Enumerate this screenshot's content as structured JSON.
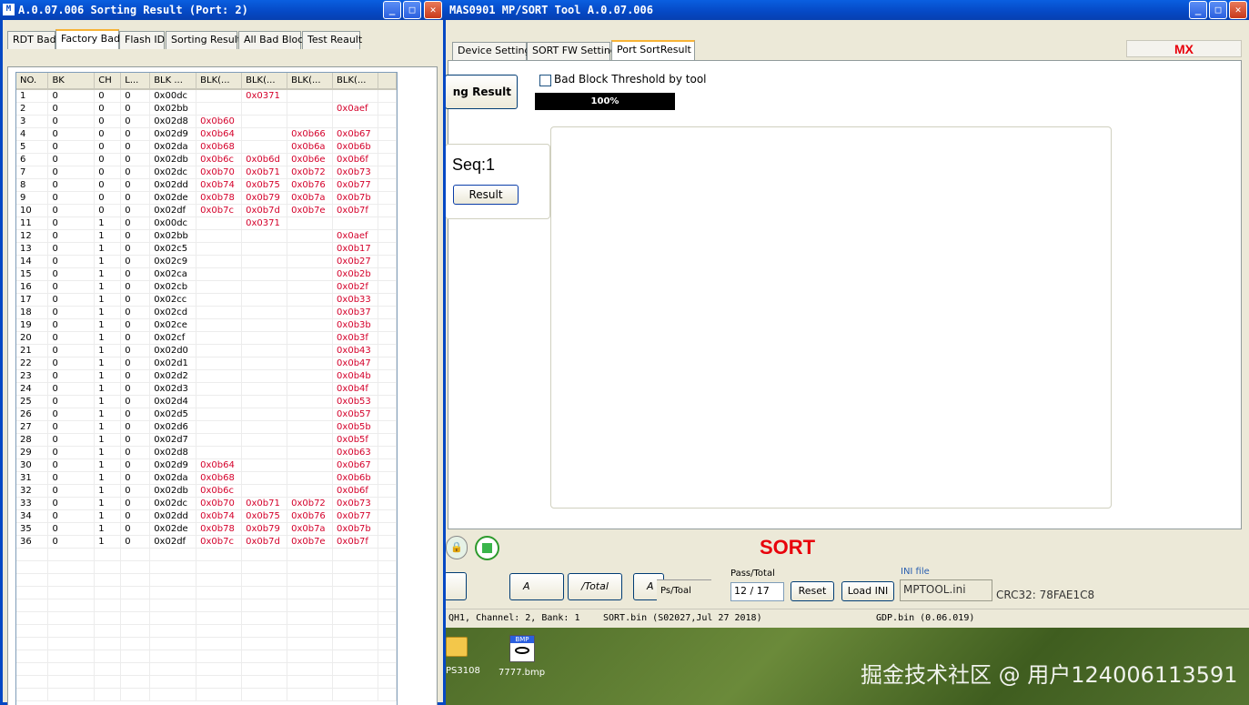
{
  "left_window": {
    "title": "A.0.07.006 Sorting Result (Port: 2)",
    "tabs": [
      "RDT Bad",
      "Factory Bad",
      "Flash ID",
      "Sorting Result",
      "All Bad Block",
      "Test Reault"
    ],
    "selected_tab": 1,
    "columns": [
      "NO.",
      "BK",
      "CH",
      "L...",
      "BLK ...",
      "BLK(...",
      "BLK(...",
      "BLK(...",
      "BLK(..."
    ],
    "rows": [
      [
        "1",
        "0",
        "0",
        "0",
        "0x00dc",
        "",
        "0x0371",
        "",
        ""
      ],
      [
        "2",
        "0",
        "0",
        "0",
        "0x02bb",
        "",
        "",
        "",
        "0x0aef"
      ],
      [
        "3",
        "0",
        "0",
        "0",
        "0x02d8",
        "0x0b60",
        "",
        "",
        ""
      ],
      [
        "4",
        "0",
        "0",
        "0",
        "0x02d9",
        "0x0b64",
        "",
        "0x0b66",
        "0x0b67"
      ],
      [
        "5",
        "0",
        "0",
        "0",
        "0x02da",
        "0x0b68",
        "",
        "0x0b6a",
        "0x0b6b"
      ],
      [
        "6",
        "0",
        "0",
        "0",
        "0x02db",
        "0x0b6c",
        "0x0b6d",
        "0x0b6e",
        "0x0b6f"
      ],
      [
        "7",
        "0",
        "0",
        "0",
        "0x02dc",
        "0x0b70",
        "0x0b71",
        "0x0b72",
        "0x0b73"
      ],
      [
        "8",
        "0",
        "0",
        "0",
        "0x02dd",
        "0x0b74",
        "0x0b75",
        "0x0b76",
        "0x0b77"
      ],
      [
        "9",
        "0",
        "0",
        "0",
        "0x02de",
        "0x0b78",
        "0x0b79",
        "0x0b7a",
        "0x0b7b"
      ],
      [
        "10",
        "0",
        "0",
        "0",
        "0x02df",
        "0x0b7c",
        "0x0b7d",
        "0x0b7e",
        "0x0b7f"
      ],
      [
        "11",
        "0",
        "1",
        "0",
        "0x00dc",
        "",
        "0x0371",
        "",
        ""
      ],
      [
        "12",
        "0",
        "1",
        "0",
        "0x02bb",
        "",
        "",
        "",
        "0x0aef"
      ],
      [
        "13",
        "0",
        "1",
        "0",
        "0x02c5",
        "",
        "",
        "",
        "0x0b17"
      ],
      [
        "14",
        "0",
        "1",
        "0",
        "0x02c9",
        "",
        "",
        "",
        "0x0b27"
      ],
      [
        "15",
        "0",
        "1",
        "0",
        "0x02ca",
        "",
        "",
        "",
        "0x0b2b"
      ],
      [
        "16",
        "0",
        "1",
        "0",
        "0x02cb",
        "",
        "",
        "",
        "0x0b2f"
      ],
      [
        "17",
        "0",
        "1",
        "0",
        "0x02cc",
        "",
        "",
        "",
        "0x0b33"
      ],
      [
        "18",
        "0",
        "1",
        "0",
        "0x02cd",
        "",
        "",
        "",
        "0x0b37"
      ],
      [
        "19",
        "0",
        "1",
        "0",
        "0x02ce",
        "",
        "",
        "",
        "0x0b3b"
      ],
      [
        "20",
        "0",
        "1",
        "0",
        "0x02cf",
        "",
        "",
        "",
        "0x0b3f"
      ],
      [
        "21",
        "0",
        "1",
        "0",
        "0x02d0",
        "",
        "",
        "",
        "0x0b43"
      ],
      [
        "22",
        "0",
        "1",
        "0",
        "0x02d1",
        "",
        "",
        "",
        "0x0b47"
      ],
      [
        "23",
        "0",
        "1",
        "0",
        "0x02d2",
        "",
        "",
        "",
        "0x0b4b"
      ],
      [
        "24",
        "0",
        "1",
        "0",
        "0x02d3",
        "",
        "",
        "",
        "0x0b4f"
      ],
      [
        "25",
        "0",
        "1",
        "0",
        "0x02d4",
        "",
        "",
        "",
        "0x0b53"
      ],
      [
        "26",
        "0",
        "1",
        "0",
        "0x02d5",
        "",
        "",
        "",
        "0x0b57"
      ],
      [
        "27",
        "0",
        "1",
        "0",
        "0x02d6",
        "",
        "",
        "",
        "0x0b5b"
      ],
      [
        "28",
        "0",
        "1",
        "0",
        "0x02d7",
        "",
        "",
        "",
        "0x0b5f"
      ],
      [
        "29",
        "0",
        "1",
        "0",
        "0x02d8",
        "",
        "",
        "",
        "0x0b63"
      ],
      [
        "30",
        "0",
        "1",
        "0",
        "0x02d9",
        "0x0b64",
        "",
        "",
        "0x0b67"
      ],
      [
        "31",
        "0",
        "1",
        "0",
        "0x02da",
        "0x0b68",
        "",
        "",
        "0x0b6b"
      ],
      [
        "32",
        "0",
        "1",
        "0",
        "0x02db",
        "0x0b6c",
        "",
        "",
        "0x0b6f"
      ],
      [
        "33",
        "0",
        "1",
        "0",
        "0x02dc",
        "0x0b70",
        "0x0b71",
        "0x0b72",
        "0x0b73"
      ],
      [
        "34",
        "0",
        "1",
        "0",
        "0x02dd",
        "0x0b74",
        "0x0b75",
        "0x0b76",
        "0x0b77"
      ],
      [
        "35",
        "0",
        "1",
        "0",
        "0x02de",
        "0x0b78",
        "0x0b79",
        "0x0b7a",
        "0x0b7b"
      ],
      [
        "36",
        "0",
        "1",
        "0",
        "0x02df",
        "0x0b7c",
        "0x0b7d",
        "0x0b7e",
        "0x0b7f"
      ]
    ],
    "empty_rows": 12
  },
  "main_window": {
    "title": "MAS0901 MP/SORT Tool A.0.07.006",
    "tabs": [
      "Device Setting",
      "SORT FW Setting",
      "Port SortResult"
    ],
    "brand": "MX",
    "sorting_result_button": "ng Result",
    "bad_block_checkbox_label": "Bad Block Threshold by tool",
    "bad_block_checked": false,
    "progress_text": "100%",
    "progress": 1.0,
    "seq_label": "Seq:1",
    "result_button": "Result",
    "mode_label": "SORT",
    "btn_a1": "A",
    "btn_total": "/Total",
    "btn_a2": "A",
    "ps_total_label": "Ps/Toal",
    "pass_total_label": "Pass/Total",
    "pass_total_value": "12 / 17",
    "reset_button": "Reset",
    "load_ini_button": "Load INI",
    "ini_file_label": "INI file",
    "ini_file_value": "MPTOOL.ini",
    "crc32": "CRC32: 78FAE1C8",
    "status_1": "QH1, Channel: 2, Bank: 1",
    "status_2": "SORT.bin (S02027,Jul 27 2018)",
    "status_3": "GDP.bin (0.06.019)"
  },
  "desktop": {
    "icon1_label": "PS3108",
    "icon2_label": "7777.bmp",
    "watermark": "掘金技术社区 @ 用户124006113591"
  },
  "colors": {
    "title_blue": "#0548c4",
    "accent_red": "#e8000b",
    "cell_red": "#d4002a",
    "progress_black": "#000000"
  }
}
